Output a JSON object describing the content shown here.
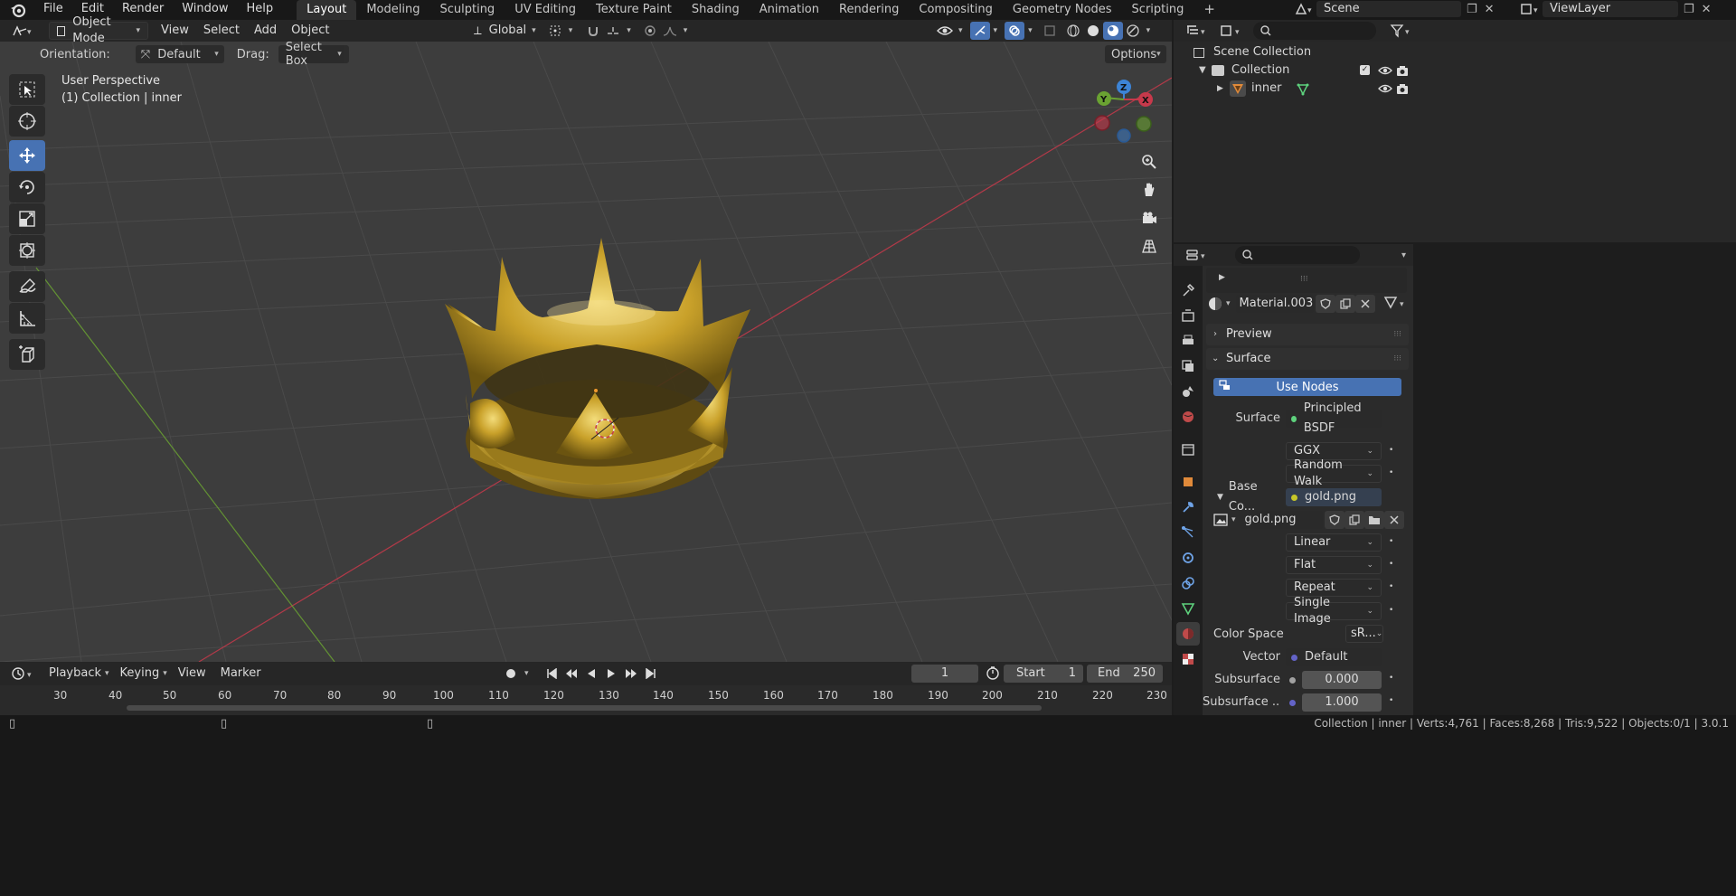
{
  "topbar": {
    "menus": [
      "File",
      "Edit",
      "Render",
      "Window",
      "Help"
    ],
    "workspaces": [
      "Layout",
      "Modeling",
      "Sculpting",
      "UV Editing",
      "Texture Paint",
      "Shading",
      "Animation",
      "Rendering",
      "Compositing",
      "Geometry Nodes",
      "Scripting"
    ],
    "active_workspace": "Layout",
    "add_tab": "+",
    "scene": "Scene",
    "view_layer": "ViewLayer"
  },
  "viewport_header": {
    "mode": "Object Mode",
    "menus": [
      "View",
      "Select",
      "Add",
      "Object"
    ],
    "transform_orientation": "Global"
  },
  "tool_settings": {
    "orientation_label": "Orientation:",
    "orientation_value": "Default",
    "drag_label": "Drag:",
    "drag_value": "Select Box",
    "options": "Options"
  },
  "viewport": {
    "perspective": "User Perspective",
    "collection_info": "(1) Collection | inner",
    "gizmo": {
      "z": "Z",
      "y": "Y",
      "x": "X"
    }
  },
  "timeline": {
    "menus": [
      "Playback",
      "Keying",
      "View",
      "Marker"
    ],
    "current_frame": "1",
    "start_label": "Start",
    "start": "1",
    "end_label": "End",
    "end": "250",
    "ticks": [
      "30",
      "40",
      "50",
      "60",
      "70",
      "80",
      "90",
      "100",
      "110",
      "120",
      "130",
      "140",
      "150",
      "160",
      "170",
      "180",
      "190",
      "200",
      "210",
      "220",
      "230"
    ]
  },
  "status": {
    "text": "Collection | inner | Verts:4,761 | Faces:8,268 | Tris:9,522 | Objects:0/1 | 3.0.1"
  },
  "outliner": {
    "scene_collection": "Scene Collection",
    "collection": "Collection",
    "object": "inner"
  },
  "properties": {
    "material_name": "Material.003",
    "preview_label": "Preview",
    "surface_panel": "Surface",
    "use_nodes": "Use Nodes",
    "surface_label": "Surface",
    "surface_value": "Principled BSDF",
    "distribution": "GGX",
    "subsurface_method": "Random Walk",
    "base_color_label": "Base Co...",
    "base_color_value": "gold.png",
    "image_name": "gold.png",
    "interpolation": "Linear",
    "projection": "Flat",
    "extension": "Repeat",
    "source": "Single Image",
    "color_space_label": "Color Space",
    "color_space_value": "sR...",
    "vector_label": "Vector",
    "vector_value": "Default",
    "subsurface_label": "Subsurface",
    "subsurface_value": "0.000",
    "subsurface2_label": "Subsurface ...",
    "subsurface2_value": "1.000"
  },
  "colors": {
    "accent": "#4772b3",
    "axis_x": "#c7394b",
    "axis_y": "#6aa232",
    "axis_z": "#3d84d6",
    "gold": "#c9a12a"
  }
}
